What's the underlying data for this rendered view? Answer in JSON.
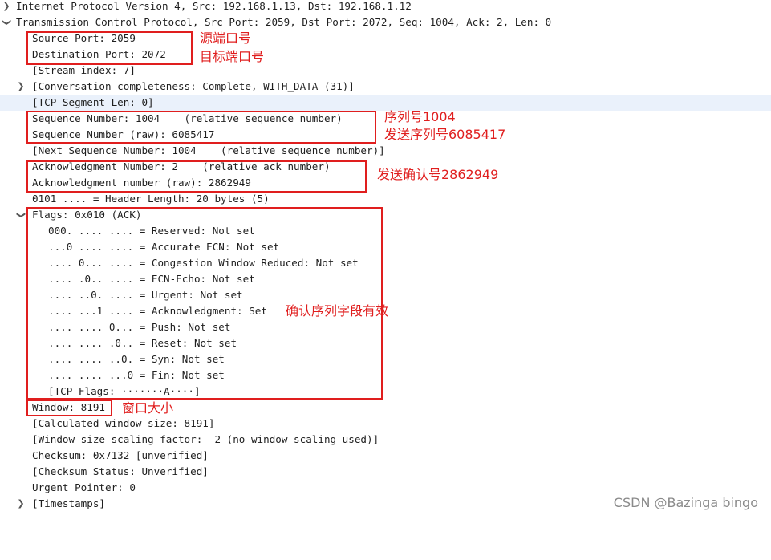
{
  "packet_tree": {
    "ip_header": "Internet Protocol Version 4, Src: 192.168.1.13, Dst: 192.168.1.12",
    "tcp_header": "Transmission Control Protocol, Src Port: 2059, Dst Port: 2072, Seq: 1004, Ack: 2, Len: 0",
    "source_port": "Source Port: 2059",
    "destination_port": "Destination Port: 2072",
    "stream_index": "[Stream index: 7]",
    "conversation_completeness": "[Conversation completeness: Complete, WITH_DATA (31)]",
    "tcp_segment_len": "[TCP Segment Len: 0]",
    "sequence_number": "Sequence Number: 1004    (relative sequence number)",
    "sequence_number_raw": "Sequence Number (raw): 6085417",
    "next_sequence_number": "[Next Sequence Number: 1004    (relative sequence number)]",
    "ack_number": "Acknowledgment Number: 2    (relative ack number)",
    "ack_number_raw": "Acknowledgment number (raw): 2862949",
    "header_length": "0101 .... = Header Length: 20 bytes (5)",
    "flags": "Flags: 0x010 (ACK)",
    "flag_reserved": "000. .... .... = Reserved: Not set",
    "flag_accurate_ecn": "...0 .... .... = Accurate ECN: Not set",
    "flag_cwr": ".... 0... .... = Congestion Window Reduced: Not set",
    "flag_ecn_echo": ".... .0.. .... = ECN-Echo: Not set",
    "flag_urgent": ".... ..0. .... = Urgent: Not set",
    "flag_ack": ".... ...1 .... = Acknowledgment: Set",
    "flag_push": ".... .... 0... = Push: Not set",
    "flag_reset": ".... .... .0.. = Reset: Not set",
    "flag_syn": ".... .... ..0. = Syn: Not set",
    "flag_fin": ".... .... ...0 = Fin: Not set",
    "tcp_flags": "[TCP Flags: ·······A····]",
    "window": "Window: 8191",
    "calculated_window_size": "[Calculated window size: 8191]",
    "window_scaling_factor": "[Window size scaling factor: -2 (no window scaling used)]",
    "checksum": "Checksum: 0x7132 [unverified]",
    "checksum_status": "[Checksum Status: Unverified]",
    "urgent_pointer": "Urgent Pointer: 0",
    "timestamps": "[Timestamps]"
  },
  "annotations": {
    "source_port_note": "源端口号",
    "dest_port_note": "目标端口号",
    "seq_note": "序列号1004",
    "seq_raw_note": "发送序列号6085417",
    "ack_raw_note": "发送确认号2862949",
    "ack_flag_note": "确认序列字段有效",
    "window_note": "窗口大小"
  },
  "watermark": "CSDN @Bazinga bingo",
  "colors": {
    "annotation_red": "#e01e1e",
    "selected_row": "#eaf1fb"
  }
}
